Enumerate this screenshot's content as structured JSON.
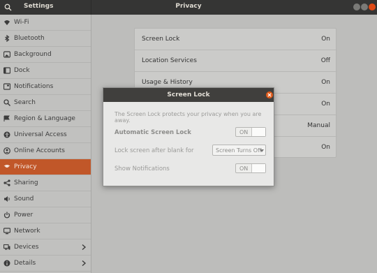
{
  "header": {
    "app_title": "Settings",
    "panel_title": "Privacy",
    "colors": {
      "bar": "#353534",
      "close": "#df4a16"
    }
  },
  "sidebar": {
    "items": [
      {
        "label": "Wi-Fi",
        "icon": "wifi-icon"
      },
      {
        "label": "Bluetooth",
        "icon": "bluetooth-icon"
      },
      {
        "label": "Background",
        "icon": "background-icon"
      },
      {
        "label": "Dock",
        "icon": "dock-icon"
      },
      {
        "label": "Notifications",
        "icon": "notifications-icon"
      },
      {
        "label": "Search",
        "icon": "search-icon"
      },
      {
        "label": "Region & Language",
        "icon": "region-icon"
      },
      {
        "label": "Universal Access",
        "icon": "universal-access-icon"
      },
      {
        "label": "Online Accounts",
        "icon": "online-accounts-icon"
      },
      {
        "label": "Privacy",
        "icon": "privacy-icon",
        "active": true
      },
      {
        "label": "Sharing",
        "icon": "sharing-icon"
      },
      {
        "label": "Sound",
        "icon": "sound-icon"
      },
      {
        "label": "Power",
        "icon": "power-icon"
      },
      {
        "label": "Network",
        "icon": "network-icon"
      },
      {
        "label": "Devices",
        "icon": "devices-icon",
        "chevron": true
      },
      {
        "label": "Details",
        "icon": "details-icon",
        "chevron": true
      }
    ],
    "accent": "#c15729"
  },
  "privacy": {
    "rows": [
      {
        "label": "Screen Lock",
        "value": "On"
      },
      {
        "label": "Location Services",
        "value": "Off"
      },
      {
        "label": "Usage & History",
        "value": "On"
      },
      {
        "label": "",
        "value": "On"
      },
      {
        "label": "",
        "value": "Manual"
      },
      {
        "label": "",
        "value": "On"
      }
    ]
  },
  "dialog": {
    "title": "Screen Lock",
    "description": "The Screen Lock protects your privacy when you are away.",
    "auto_lock_label": "Automatic Screen Lock",
    "auto_lock_state": "ON",
    "blank_label": "Lock screen after blank for",
    "blank_value": "Screen Turns Off",
    "notifications_label": "Show Notifications",
    "notifications_state": "ON"
  }
}
